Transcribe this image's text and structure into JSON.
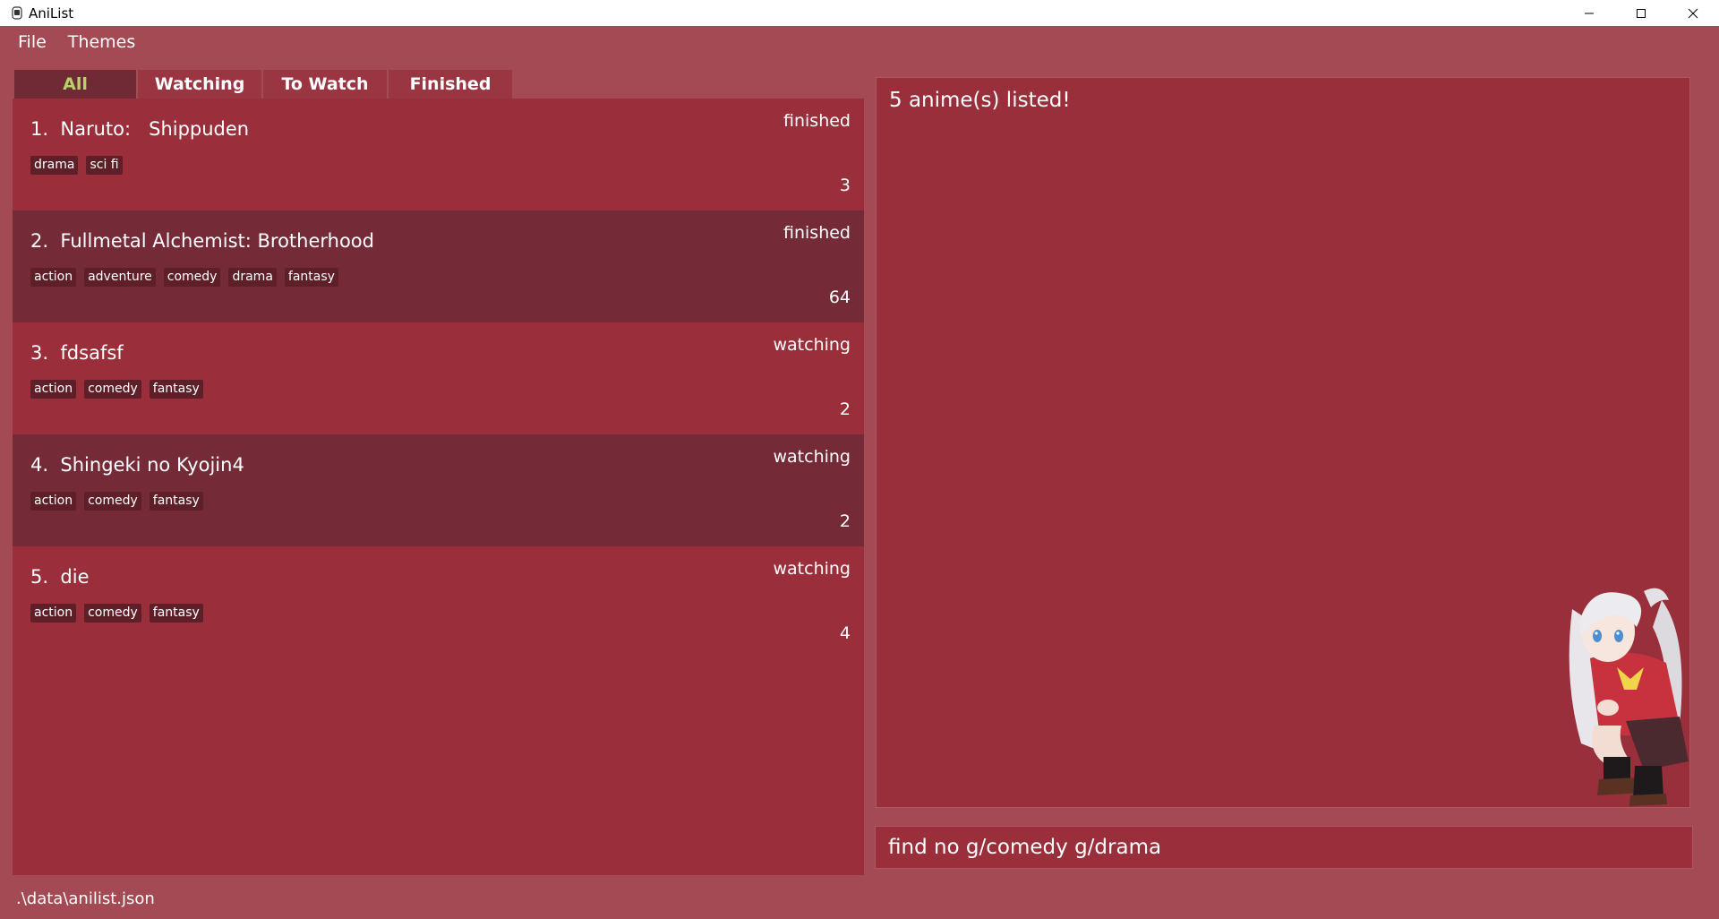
{
  "window": {
    "title": "AniList",
    "icon": "app-icon",
    "controls": [
      "minimize-icon",
      "maximize-icon",
      "close-icon"
    ]
  },
  "menu": {
    "items": [
      {
        "label": "File"
      },
      {
        "label": "Themes"
      }
    ]
  },
  "tabs": [
    {
      "label": "All",
      "active": true
    },
    {
      "label": "Watching",
      "active": false
    },
    {
      "label": "To Watch",
      "active": false
    },
    {
      "label": "Finished",
      "active": false
    }
  ],
  "anime_list": [
    {
      "index": "1.",
      "name": "Naruto:   Shippuden",
      "status": "finished",
      "episodes": "3",
      "tags": [
        "drama",
        "sci fi"
      ]
    },
    {
      "index": "2.",
      "name": "Fullmetal Alchemist: Brotherhood",
      "status": "finished",
      "episodes": "64",
      "tags": [
        "action",
        "adventure",
        "comedy",
        "drama",
        "fantasy"
      ]
    },
    {
      "index": "3.",
      "name": "fdsafsf",
      "status": "watching",
      "episodes": "2",
      "tags": [
        "action",
        "comedy",
        "fantasy"
      ]
    },
    {
      "index": "4.",
      "name": "Shingeki no Kyojin4",
      "status": "watching",
      "episodes": "2",
      "tags": [
        "action",
        "comedy",
        "fantasy"
      ]
    },
    {
      "index": "5.",
      "name": "die",
      "status": "watching",
      "episodes": "4",
      "tags": [
        "action",
        "comedy",
        "fantasy"
      ]
    }
  ],
  "result": {
    "message": "5 anime(s) listed!"
  },
  "command": {
    "value": "find no g/comedy g/drama"
  },
  "status_bar": {
    "path": ".\\data\\anilist.json"
  },
  "colors": {
    "background": "#a34a54",
    "card": "#9a2f3b",
    "card_alt": "#752b37",
    "tag": "#5e1f29",
    "active_tab_text": "#b7d26a"
  }
}
